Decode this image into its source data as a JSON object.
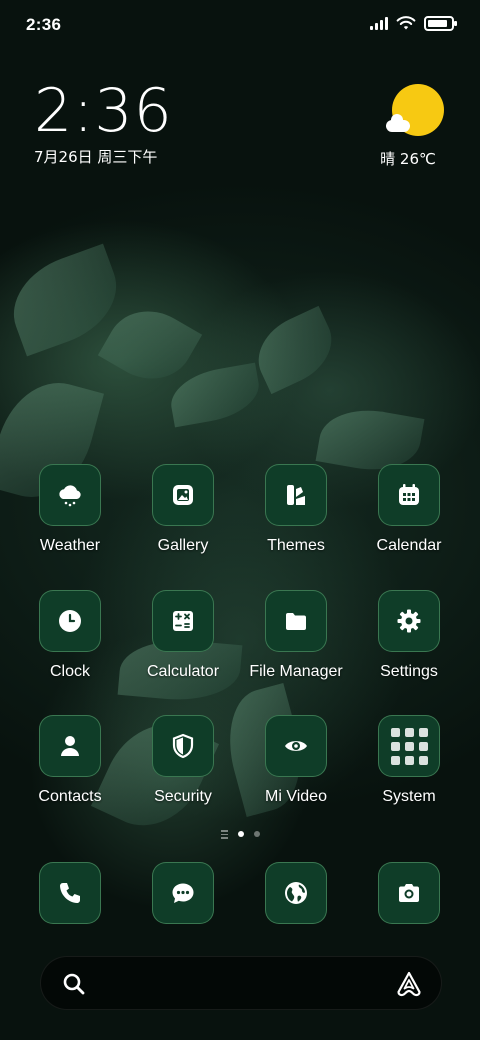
{
  "status_bar": {
    "time": "2:36",
    "battery_level": 0.85,
    "signal_bars": 4
  },
  "clock_widget": {
    "time": "2:36",
    "date": "7月26日 周三下午"
  },
  "weather_widget": {
    "icon": "sun-cloud-icon",
    "text": "晴 26℃"
  },
  "apps": [
    {
      "label": "Weather",
      "icon": "weather-cloud-icon"
    },
    {
      "label": "Gallery",
      "icon": "gallery-icon"
    },
    {
      "label": "Themes",
      "icon": "themes-icon"
    },
    {
      "label": "Calendar",
      "icon": "calendar-icon"
    },
    {
      "label": "Clock",
      "icon": "clock-icon"
    },
    {
      "label": "Calculator",
      "icon": "calculator-icon"
    },
    {
      "label": "File Manager",
      "icon": "folder-icon"
    },
    {
      "label": "Settings",
      "icon": "gear-icon"
    },
    {
      "label": "Contacts",
      "icon": "person-icon"
    },
    {
      "label": "Security",
      "icon": "shield-icon"
    },
    {
      "label": "Mi Video",
      "icon": "eye-icon"
    },
    {
      "label": "System",
      "icon": "folder-grid-icon"
    }
  ],
  "page_indicator": {
    "pages": 2,
    "active": 1
  },
  "dock": [
    {
      "icon": "phone-icon"
    },
    {
      "icon": "message-icon"
    },
    {
      "icon": "browser-globe-icon"
    },
    {
      "icon": "camera-icon"
    }
  ],
  "search_bar": {
    "left_icon": "search-icon",
    "right_icon": "assistant-icon"
  },
  "colors": {
    "icon_bg": "#0f3d28",
    "icon_border": "#6ebe82",
    "sun": "#f7c912"
  }
}
